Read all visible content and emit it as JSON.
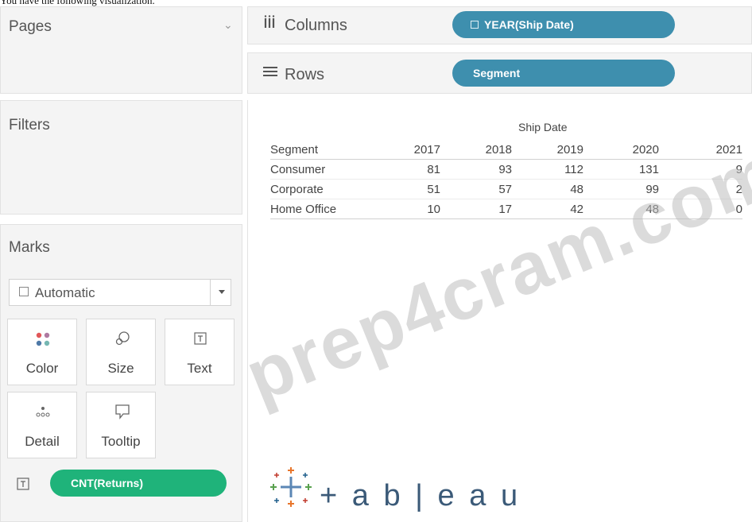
{
  "caption": "You have the following visualization.",
  "pages": {
    "title": "Pages",
    "chevron": "⌄"
  },
  "filters": {
    "title": "Filters"
  },
  "marks": {
    "title": "Marks",
    "mark_type": "Automatic",
    "cards": [
      {
        "label": "Color",
        "icon": "color-dots-icon"
      },
      {
        "label": "Size",
        "icon": "size-icon"
      },
      {
        "label": "Text",
        "icon": "text-icon"
      },
      {
        "label": "Detail",
        "icon": "detail-icon"
      },
      {
        "label": "Tooltip",
        "icon": "tooltip-icon"
      }
    ],
    "field_pill": "CNT(Returns)",
    "field_pill_color": "#1fb37a"
  },
  "columns_shelf": {
    "label": "Columns",
    "pill": "YEAR(Ship Date)"
  },
  "rows_shelf": {
    "label": "Rows",
    "pill": "Segment"
  },
  "pill_color": "#3e8fae",
  "table": {
    "column_group": "Ship Date",
    "row_header": "Segment",
    "years": [
      "2017",
      "2018",
      "2019",
      "2020",
      "2021"
    ],
    "rows": [
      {
        "segment": "Consumer",
        "values": [
          "81",
          "93",
          "112",
          "131",
          "9"
        ]
      },
      {
        "segment": "Corporate",
        "values": [
          "51",
          "57",
          "48",
          "99",
          "2"
        ]
      },
      {
        "segment": "Home Office",
        "values": [
          "10",
          "17",
          "42",
          "48",
          "0"
        ]
      }
    ]
  },
  "watermark": "prep4cram.com",
  "logo_text": "+ a b | e a u"
}
